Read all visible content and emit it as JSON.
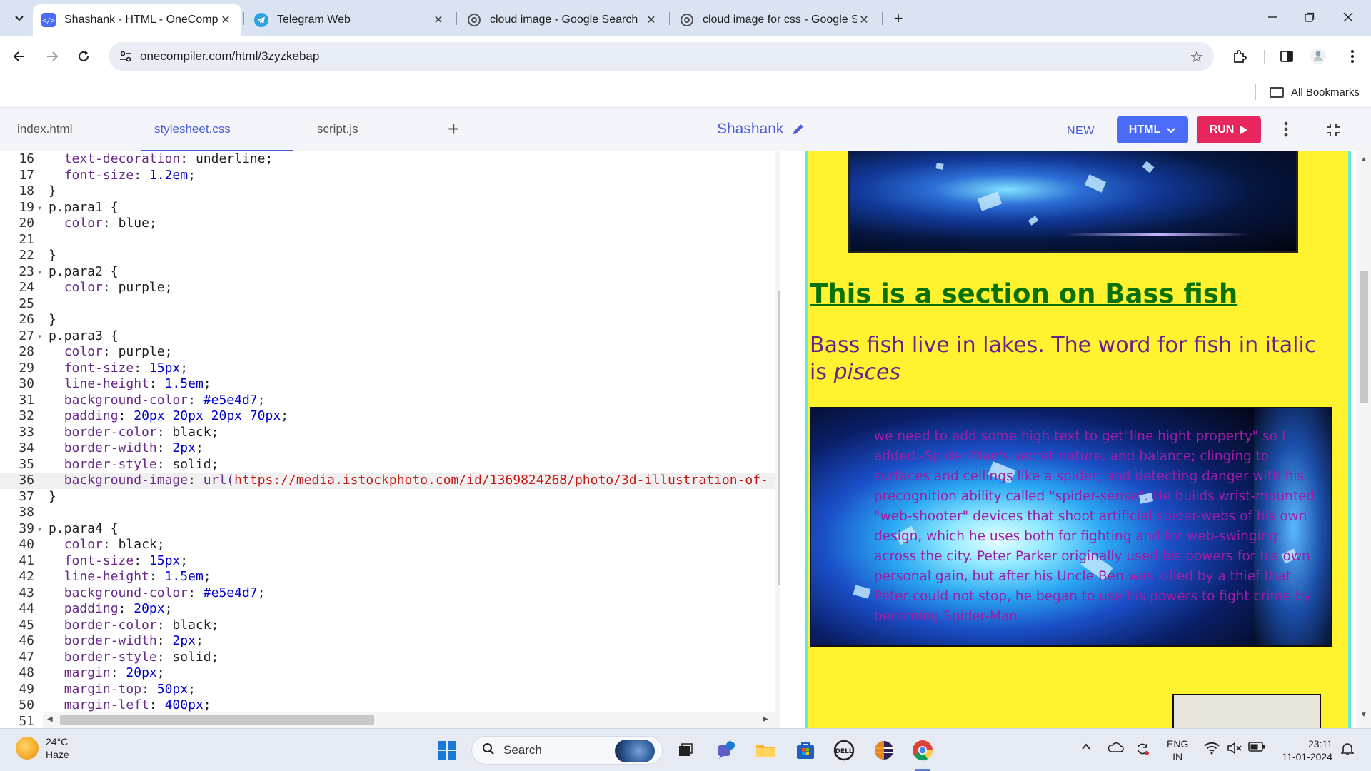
{
  "browser": {
    "tabs": [
      {
        "title": "Shashank - HTML - OneCompil",
        "active": true,
        "favicon": "onecompiler-icon"
      },
      {
        "title": "Telegram Web",
        "active": false,
        "favicon": "telegram-icon"
      },
      {
        "title": "cloud image - Google Search",
        "active": false,
        "favicon": "google-search-icon"
      },
      {
        "title": "cloud image for css - Google Se",
        "active": false,
        "favicon": "google-search-icon"
      }
    ],
    "url": "onecompiler.com/html/3zyzkebap",
    "bookmarks_label": "All Bookmarks"
  },
  "onecompiler": {
    "file_tabs": [
      "index.html",
      "stylesheet.css",
      "script.js"
    ],
    "active_tab": "stylesheet.css",
    "project_name": "Shashank",
    "new_label": "NEW",
    "language_label": "HTML",
    "run_label": "RUN"
  },
  "editor": {
    "current_line": 36,
    "lines": [
      {
        "n": 16,
        "fold": false,
        "text": "  text-decoration: underline;"
      },
      {
        "n": 17,
        "fold": false,
        "text": "  font-size: 1.2em;"
      },
      {
        "n": 18,
        "fold": false,
        "text": "}"
      },
      {
        "n": 19,
        "fold": true,
        "text": "p.para1 {"
      },
      {
        "n": 20,
        "fold": false,
        "text": "  color: blue;"
      },
      {
        "n": 21,
        "fold": false,
        "text": ""
      },
      {
        "n": 22,
        "fold": false,
        "text": "}"
      },
      {
        "n": 23,
        "fold": true,
        "text": "p.para2 {"
      },
      {
        "n": 24,
        "fold": false,
        "text": "  color: purple;"
      },
      {
        "n": 25,
        "fold": false,
        "text": ""
      },
      {
        "n": 26,
        "fold": false,
        "text": "}"
      },
      {
        "n": 27,
        "fold": true,
        "text": "p.para3 {"
      },
      {
        "n": 28,
        "fold": false,
        "text": "  color: purple;"
      },
      {
        "n": 29,
        "fold": false,
        "text": "  font-size: 15px;"
      },
      {
        "n": 30,
        "fold": false,
        "text": "  line-height: 1.5em;"
      },
      {
        "n": 31,
        "fold": false,
        "text": "  background-color: #e5e4d7;"
      },
      {
        "n": 32,
        "fold": false,
        "text": "  padding: 20px 20px 20px 70px;"
      },
      {
        "n": 33,
        "fold": false,
        "text": "  border-color: black;"
      },
      {
        "n": 34,
        "fold": false,
        "text": "  border-width: 2px;"
      },
      {
        "n": 35,
        "fold": false,
        "text": "  border-style: solid;"
      },
      {
        "n": 36,
        "fold": false,
        "text": "  background-image: url(https://media.istockphoto.com/id/1369824268/photo/3d-illustration-of-"
      },
      {
        "n": 37,
        "fold": false,
        "text": "}"
      },
      {
        "n": 38,
        "fold": false,
        "text": ""
      },
      {
        "n": 39,
        "fold": true,
        "text": "p.para4 {"
      },
      {
        "n": 40,
        "fold": false,
        "text": "  color: black;"
      },
      {
        "n": 41,
        "fold": false,
        "text": "  font-size: 15px;"
      },
      {
        "n": 42,
        "fold": false,
        "text": "  line-height: 1.5em;"
      },
      {
        "n": 43,
        "fold": false,
        "text": "  background-color: #e5e4d7;"
      },
      {
        "n": 44,
        "fold": false,
        "text": "  padding: 20px;"
      },
      {
        "n": 45,
        "fold": false,
        "text": "  border-color: black;"
      },
      {
        "n": 46,
        "fold": false,
        "text": "  border-width: 2px;"
      },
      {
        "n": 47,
        "fold": false,
        "text": "  border-style: solid;"
      },
      {
        "n": 48,
        "fold": false,
        "text": "  margin: 20px;"
      },
      {
        "n": 49,
        "fold": false,
        "text": "  margin-top: 50px;"
      },
      {
        "n": 50,
        "fold": false,
        "text": "  margin-left: 400px;"
      },
      {
        "n": 51,
        "fold": false,
        "text": ""
      }
    ]
  },
  "preview": {
    "heading": "This is a section on Bass fish",
    "para_text": "Bass fish live in lakes. The word for fish in italic is ",
    "para_italic": "pisces",
    "box_text": "we need to add some high text to get\"line hight property\" so I added:-Spider-Man's secret nature, and balance; clinging to surfaces and ceilings like a spider; and detecting danger with his precognition ability called \"spider-sense\". He builds wrist-mounted \"web-shooter\" devices that shoot artificial spider-webs of his own design, which he uses both for fighting and for web-swinging across the city. Peter Parker originally used his powers for his own personal gain, but after his Uncle Ben was killed by a thief that Peter could not stop, he began to use his powers to fight crime by becoming Spider-Man",
    "colors": {
      "background": "#fff22e",
      "heading": "#087208",
      "para": "#6a1f8c",
      "box_text": "#9b1fa6"
    }
  },
  "taskbar": {
    "weather_temp": "24°C",
    "weather_desc": "Haze",
    "search_placeholder": "Search",
    "chat_badge": "1",
    "lang_1": "ENG",
    "lang_2": "IN",
    "time": "23:11",
    "date": "11-01-2024"
  }
}
